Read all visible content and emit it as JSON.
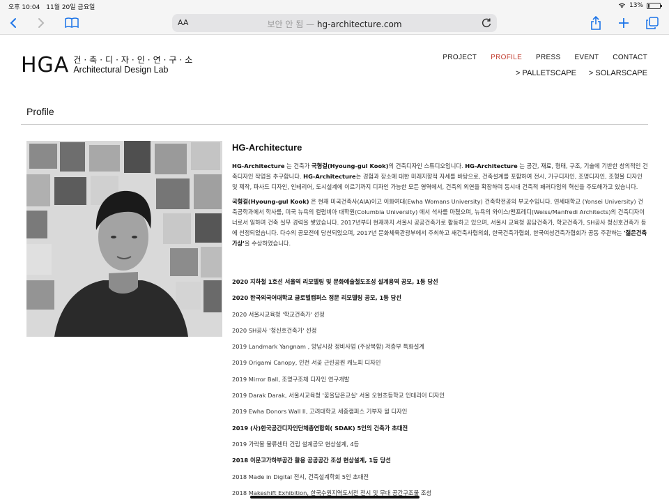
{
  "status_bar": {
    "time": "오후 10:04",
    "date": "11월 20일 금요일",
    "battery": "13%",
    "battery_level": 0.13
  },
  "browser": {
    "aa_label": "AA",
    "insecure_label": "보안 안 됨",
    "url_separator": " — ",
    "url": "hg-architecture.com"
  },
  "site": {
    "logo_mark": "HGA",
    "logo_korean": "건·축·디·자·인·연·구·소",
    "logo_english": "Architectural Design Lab",
    "nav": [
      {
        "label": "PROJECT",
        "active": false
      },
      {
        "label": "PROFILE",
        "active": true
      },
      {
        "label": "PRESS",
        "active": false
      },
      {
        "label": "EVENT",
        "active": false
      },
      {
        "label": "CONTACT",
        "active": false
      }
    ],
    "subnav": [
      {
        "label": "> PALLETSCAPE"
      },
      {
        "label": "> SOLARSCAPE"
      }
    ],
    "active_color": "#c0392b"
  },
  "page": {
    "title": "Profile",
    "content_title": "HG-Architecture",
    "para1": [
      {
        "t": "HG-Architecture",
        "b": true
      },
      {
        "t": " 는  건축가 ",
        "b": false
      },
      {
        "t": "국형걸(Hyoung-gul Kook)",
        "b": true
      },
      {
        "t": "의 건축디자인 스튜디오입니다. ",
        "b": false
      },
      {
        "t": "HG-Architecture",
        "b": true
      },
      {
        "t": " 는 공간, 재료, 형태, 구조, 기술에 기반한  창의적인 건축디자인 작업을 추구합니다. ",
        "b": false
      },
      {
        "t": "HG-Architecture",
        "b": true
      },
      {
        "t": "는 경험과 장소에 대한 미래지향적 자세를 바탕으로,  건축설계를 포함하여 전시, 가구디자인, 조명디자인, 조형물 디자인 및 제작, 파사드 디자인, 인테리어, 도시설계에 이르기까지 디자인 가능한 모든 영역에서, 건축의 외연을 확장하며 동시대 건축적 패러다임의 혁신을 주도해가고 있습니다.",
        "b": false
      }
    ],
    "para2": [
      {
        "t": "국형걸(Hyoung-gul Kook)",
        "b": true
      },
      {
        "t": " 은 현재 미국건축사(AIA)이고 이화여대(Ewha Womans University) 건축학전공의 부교수입니다. 연세대학교 (Yonsei University) 건축공학과에서 학사를, 미국 뉴욕의 컬럼비아 대학원(Columbia University) 에서 석사를 마쳤으며, 뉴욕의 와이스/맨프레디(Weiss/Manfredi Architects)의 건축디자이너로서 일하며 건축 실무 경력을 쌓았습니다. 2017년부터 현재까지 서울시 공공건축가로 활동하고 있으며, 서울시 교육청 꿈담건축가, 학교건축가, SH공사 청신호건축가 등에 선정되었습니다. 다수의 공모전에 당선되었으며, 2017년 문화체육관광부에서 주최하고 새건축사협의회, 한국건축가협회, 한국여성건축가협회가 공동 주관하는 ",
        "b": false
      },
      {
        "t": "'젊은건축가상'",
        "b": true
      },
      {
        "t": "을 수상하였습니다.",
        "b": false
      }
    ],
    "achievements": [
      {
        "text": "2020 지하철 1호선 서울역 리모델링 및 문화예술철도조성 설계용역 공모, 1등 당선",
        "bold": true
      },
      {
        "text": "2020 한국외국어대학교 글로벌캠퍼스 정문 리모델링 공모, 1등 당선",
        "bold": true
      },
      {
        "text": "2020 서울시교육청 '학교건축가' 선정",
        "bold": false
      },
      {
        "text": "2020 SH공사 '청신호건축가' 선정",
        "bold": false
      },
      {
        "text": "2019 Landmark Yangnam , 양남시장 정비사업 (주상복합)  저층부 특화설계",
        "bold": false
      },
      {
        "text": "2019 Origami Canopy, 인천 서곶 근린공원 캐노피 디자인",
        "bold": false
      },
      {
        "text": "2019 Mirror Ball, 조명구조체 디자인 연구개발",
        "bold": false
      },
      {
        "text": "2019 Darak Darak, 서울시교육청 '꿈을담은교실' 서울 오현초등학교 인테리어 디자인",
        "bold": false
      },
      {
        "text": "2019 Ewha Donors Wall II, 고려대학교 세종캠퍼스 기부자 월 디자인",
        "bold": false
      },
      {
        "text": "2019 (사)한국공간디자인단체총연합회( SDAK)   5인의 건축가 초대전",
        "bold": true
      },
      {
        "text": "2019 가락몰 물류센터 건립 설계공모 현상설계, 4등",
        "bold": false
      },
      {
        "text": "2018 이문고가하부공간 활용 공공공간 조성 현상설계, 1등 당선",
        "bold": true
      },
      {
        "text": "2018 Made in Digital 전시, 건축설계학회 5인 초대전",
        "bold": false
      },
      {
        "text": "2018 Makeshift Exhibition, 한국수원지역도서전 전시 및 무대 공간구조물 조성",
        "bold": false
      }
    ]
  }
}
